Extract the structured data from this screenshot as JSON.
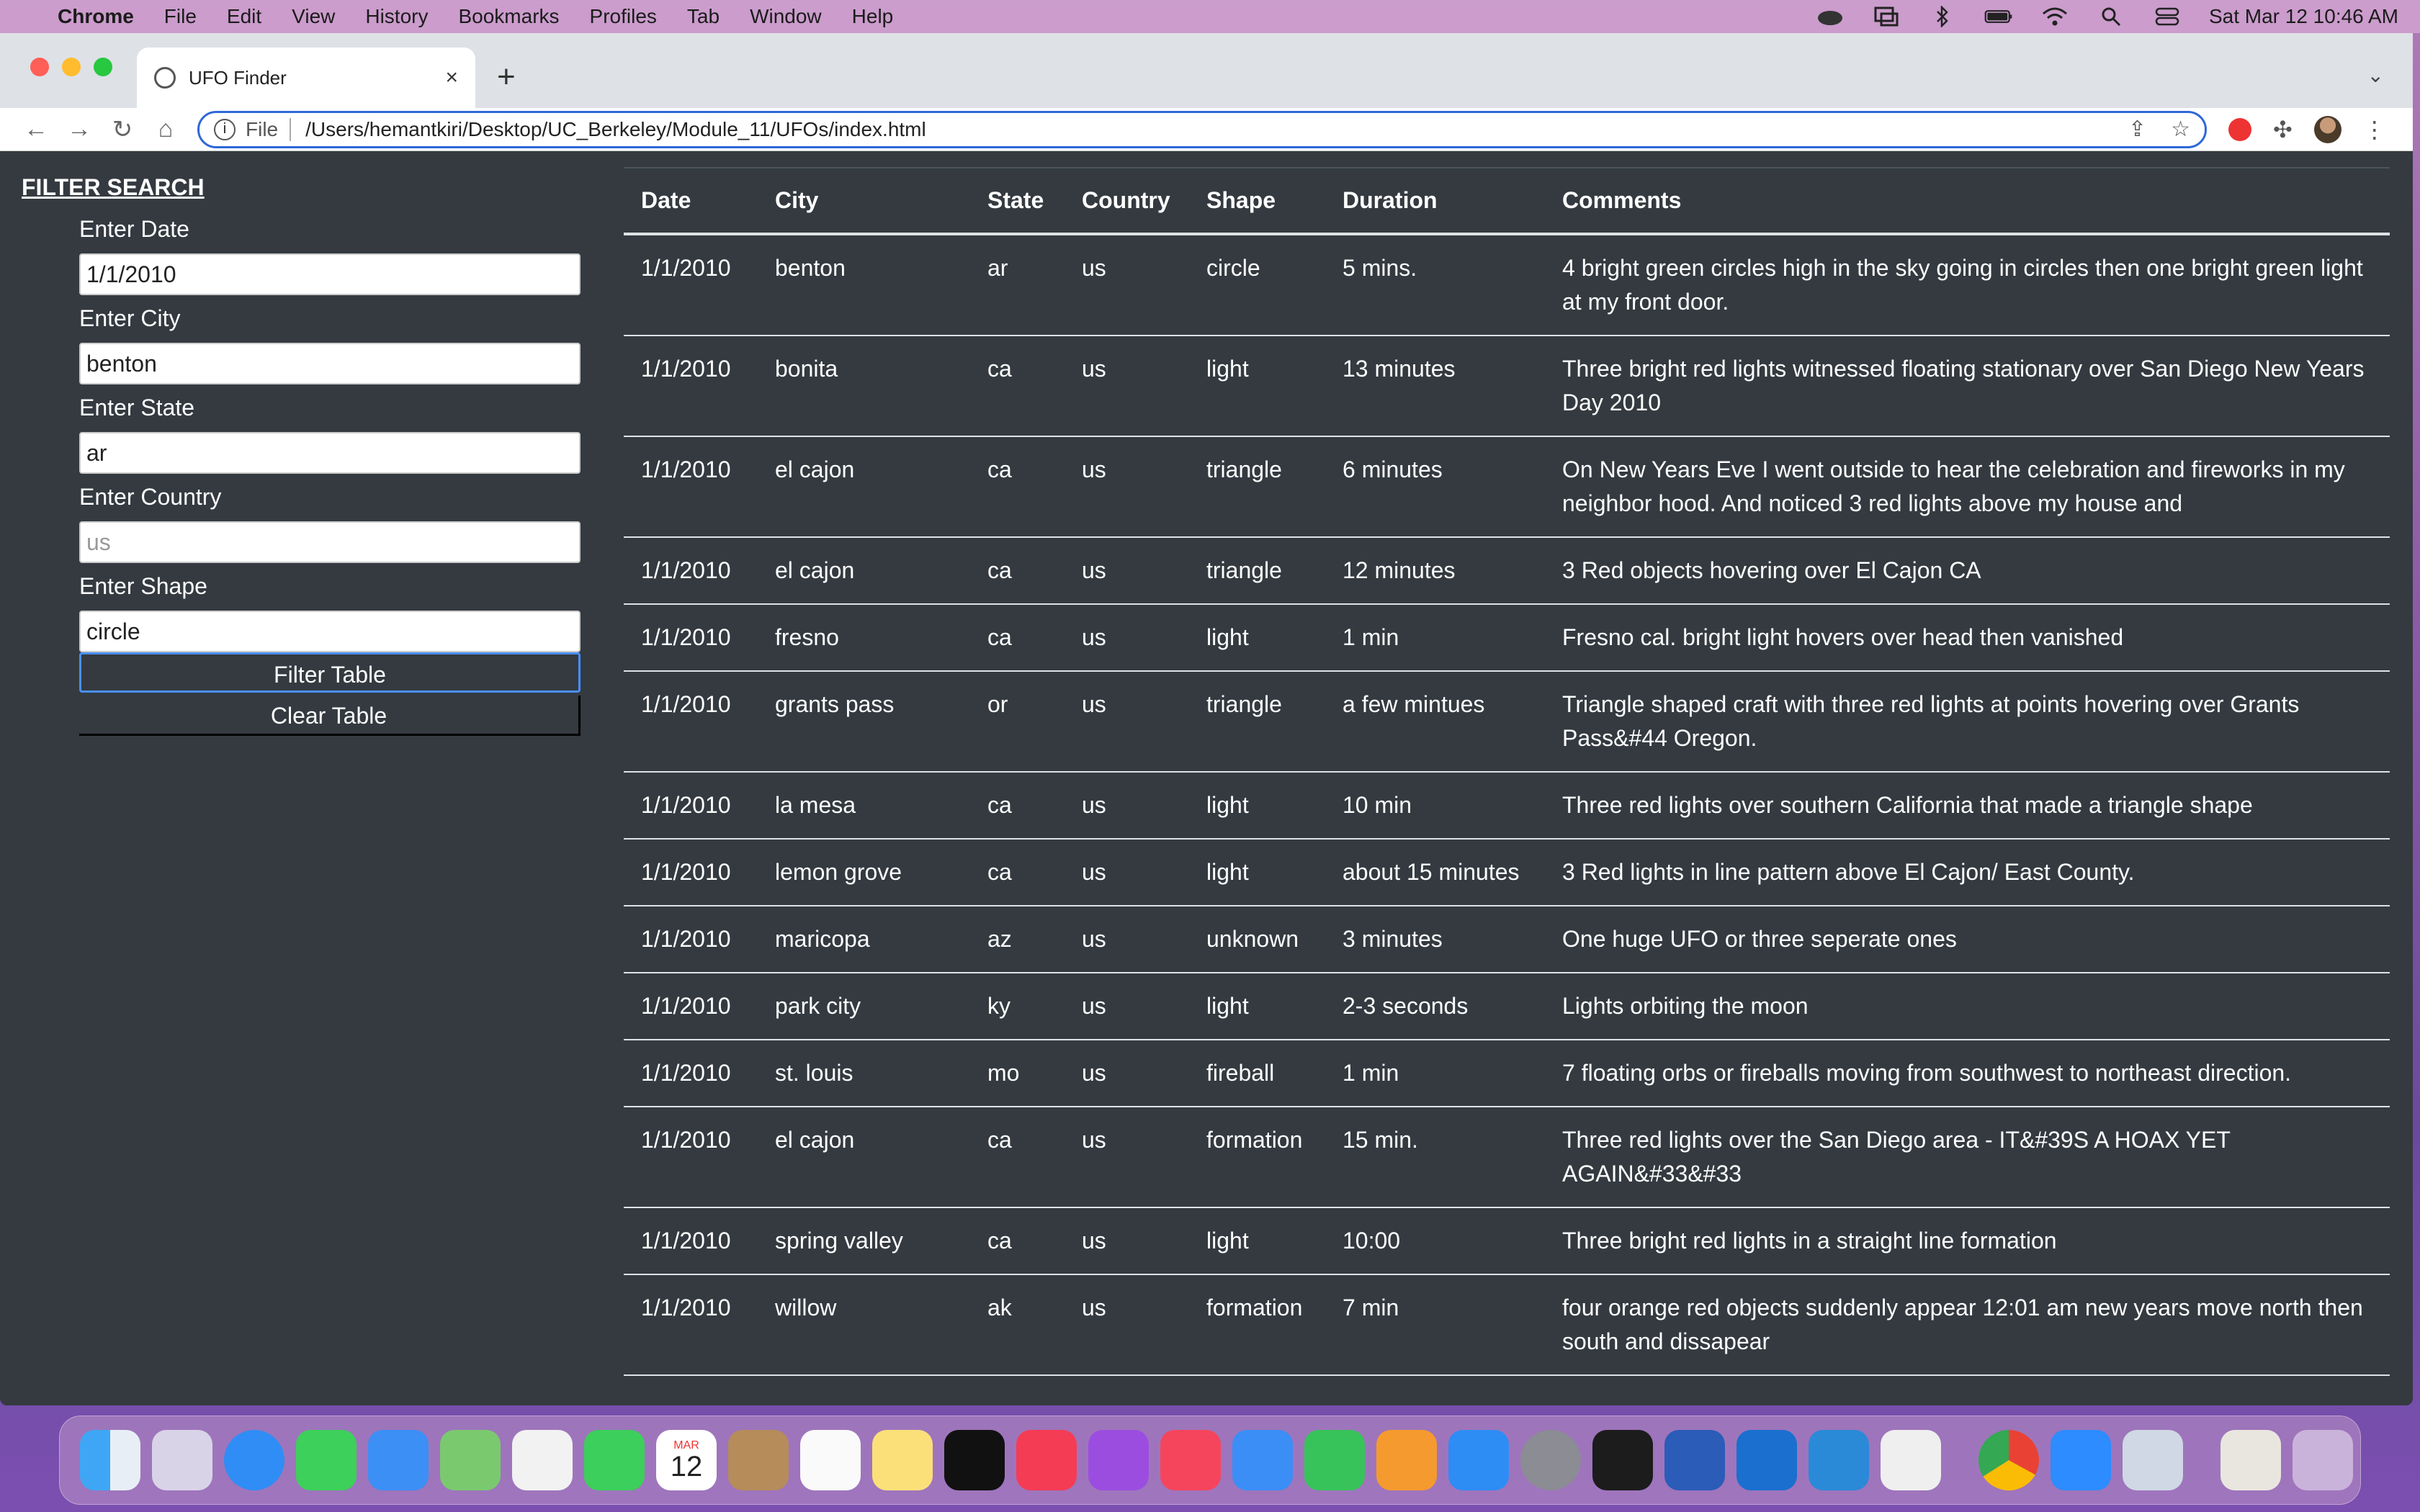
{
  "menubar": {
    "app": "Chrome",
    "items": [
      "File",
      "Edit",
      "View",
      "History",
      "Bookmarks",
      "Profiles",
      "Tab",
      "Window",
      "Help"
    ],
    "clock": "Sat Mar 12  10:46 AM"
  },
  "browser": {
    "tab_title": "UFO Finder",
    "scheme_label": "File",
    "url": "/Users/hemantkiri/Desktop/UC_Berkeley/Module_11/UFOs/index.html"
  },
  "sidebar": {
    "title": "FILTER SEARCH",
    "fields": [
      {
        "label": "Enter Date",
        "value": "1/1/2010",
        "placeholder": ""
      },
      {
        "label": "Enter City",
        "value": "benton",
        "placeholder": ""
      },
      {
        "label": "Enter State",
        "value": "ar",
        "placeholder": ""
      },
      {
        "label": "Enter Country",
        "value": "",
        "placeholder": "us"
      },
      {
        "label": "Enter Shape",
        "value": "circle",
        "placeholder": ""
      }
    ],
    "filter_button": "Filter Table",
    "clear_button": "Clear Table"
  },
  "table": {
    "headers": [
      "Date",
      "City",
      "State",
      "Country",
      "Shape",
      "Duration",
      "Comments"
    ],
    "rows": [
      [
        "1/1/2010",
        "benton",
        "ar",
        "us",
        "circle",
        "5 mins.",
        "4 bright green circles high in the sky going in circles then one bright green light at my front door."
      ],
      [
        "1/1/2010",
        "bonita",
        "ca",
        "us",
        "light",
        "13 minutes",
        "Three bright red lights witnessed floating stationary over San Diego New Years Day 2010"
      ],
      [
        "1/1/2010",
        "el cajon",
        "ca",
        "us",
        "triangle",
        "6 minutes",
        "On New Years Eve I went outside to hear the celebration and fireworks in my neighbor hood. And noticed 3 red lights above my house and"
      ],
      [
        "1/1/2010",
        "el cajon",
        "ca",
        "us",
        "triangle",
        "12 minutes",
        "3 Red objects hovering over El Cajon CA"
      ],
      [
        "1/1/2010",
        "fresno",
        "ca",
        "us",
        "light",
        "1 min",
        "Fresno cal. bright light hovers over head then vanished"
      ],
      [
        "1/1/2010",
        "grants pass",
        "or",
        "us",
        "triangle",
        "a few mintues",
        "Triangle shaped craft with three red lights at points hovering over Grants Pass&#44 Oregon."
      ],
      [
        "1/1/2010",
        "la mesa",
        "ca",
        "us",
        "light",
        "10 min",
        "Three red lights over southern California that made a triangle shape"
      ],
      [
        "1/1/2010",
        "lemon grove",
        "ca",
        "us",
        "light",
        "about 15 minutes",
        "3 Red lights in line pattern above El Cajon/ East County."
      ],
      [
        "1/1/2010",
        "maricopa",
        "az",
        "us",
        "unknown",
        "3 minutes",
        "One huge UFO or three seperate ones"
      ],
      [
        "1/1/2010",
        "park city",
        "ky",
        "us",
        "light",
        "2-3 seconds",
        "Lights orbiting the moon"
      ],
      [
        "1/1/2010",
        "st. louis",
        "mo",
        "us",
        "fireball",
        "1 min",
        "7 floating orbs or fireballs moving from southwest to northeast direction."
      ],
      [
        "1/1/2010",
        "el cajon",
        "ca",
        "us",
        "formation",
        "15 min.",
        "Three red lights over the San Diego area - IT&#39S A HOAX YET AGAIN&#33&#33"
      ],
      [
        "1/1/2010",
        "spring valley",
        "ca",
        "us",
        "light",
        "10:00",
        "Three bright red lights in a straight line formation"
      ],
      [
        "1/1/2010",
        "willow",
        "ak",
        "us",
        "formation",
        "7 min",
        "four orange red objects suddenly appear 12:01 am new years move north then south and dissapear"
      ]
    ]
  },
  "dock": {
    "calendar_month": "MAR",
    "calendar_day": "12",
    "apps": [
      "finder-icon",
      "launchpad-icon",
      "safari-icon",
      "messages-icon",
      "mail-icon",
      "maps-icon",
      "photos-icon",
      "facetime-icon",
      "calendar-icon",
      "contacts-icon",
      "reminders-icon",
      "notes-icon",
      "tv-icon",
      "music-icon",
      "podcasts-icon",
      "news-icon",
      "keynote-icon",
      "numbers-icon",
      "pages-icon",
      "app-store-icon",
      "system-preferences-icon",
      "terminal-icon",
      "word-icon",
      "outlook-icon",
      "vscode-icon",
      "textedit-icon",
      "chrome-icon",
      "zoom-icon",
      "preview-icon",
      "documents-icon",
      "trash-icon"
    ]
  }
}
